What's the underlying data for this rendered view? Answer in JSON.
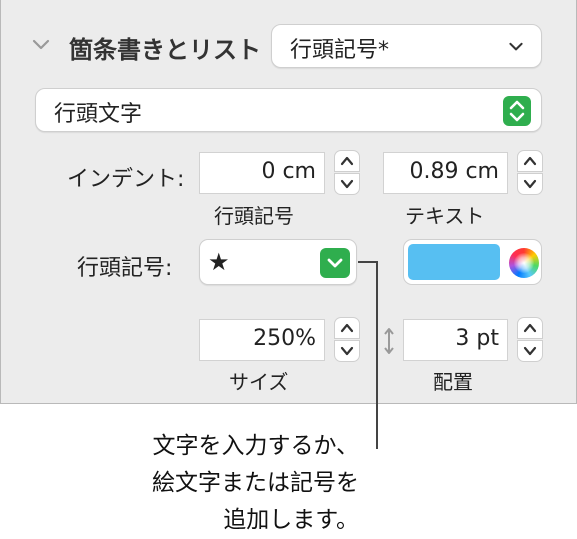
{
  "section": {
    "title": "箇条書きとリスト",
    "list_style_value": "行頭記号*"
  },
  "bullet_type": {
    "value": "行頭文字"
  },
  "indent": {
    "label": "インデント:",
    "bullet_value": "0 cm",
    "bullet_caption": "行頭記号",
    "text_value": "0.89 cm",
    "text_caption": "テキスト"
  },
  "bullet": {
    "label": "行頭記号:",
    "symbol": "★",
    "color": "#57bff2"
  },
  "size": {
    "value": "250%",
    "caption": "サイズ"
  },
  "align": {
    "value": "3 pt",
    "caption": "配置"
  },
  "callout": {
    "line1": "文字を入力するか、",
    "line2": "絵文字または記号を",
    "line3": "追加します。"
  }
}
